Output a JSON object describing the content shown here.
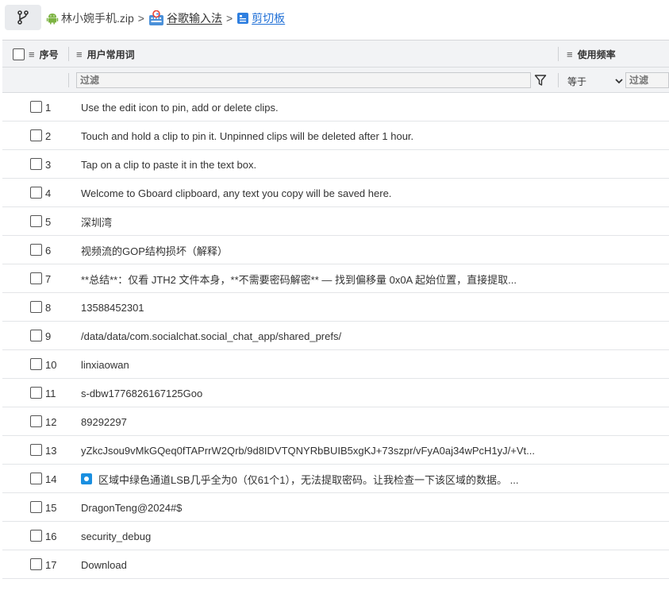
{
  "breadcrumb": {
    "items": [
      {
        "label": "林小婉手机.zip",
        "icon": "android-icon",
        "active": false
      },
      {
        "label": "谷歌输入法",
        "icon": "google-keyboard-icon",
        "active": false
      },
      {
        "label": "剪切板",
        "icon": "clipboard-icon",
        "active": true
      }
    ],
    "separator": ">"
  },
  "table": {
    "columns": {
      "index": "序号",
      "phrase": "用户常用词",
      "frequency": "使用频率"
    },
    "filter": {
      "phrase_placeholder": "过滤",
      "operator": "等于",
      "frequency_placeholder": "过滤"
    },
    "rows": [
      {
        "index": "1",
        "text": "Use the edit icon to pin, add or delete clips."
      },
      {
        "index": "2",
        "text": "Touch and hold a clip to pin it. Unpinned clips will be deleted after 1 hour."
      },
      {
        "index": "3",
        "text": "Tap on a clip to paste it in the text box."
      },
      {
        "index": "4",
        "text": "Welcome to Gboard clipboard, any text you copy will be saved here."
      },
      {
        "index": "5",
        "text": "深圳湾"
      },
      {
        "index": "6",
        "text": "视频流的GOP结构损坏（解释）"
      },
      {
        "index": "7",
        "text": "**总结**：仅看 JTH2 文件本身，**不需要密码解密** — 找到偏移量 0x0A 起始位置，直接提取..."
      },
      {
        "index": "8",
        "text": "13588452301"
      },
      {
        "index": "9",
        "text": "/data/data/com.socialchat.social_chat_app/shared_prefs/"
      },
      {
        "index": "10",
        "text": "linxiaowan"
      },
      {
        "index": "11",
        "text": "s-dbw1776826167125Goo"
      },
      {
        "index": "12",
        "text": "89292297"
      },
      {
        "index": "13",
        "text": "yZkcJsou9vMkGQeq0fTAPrrW2Qrb/9d8IDVTQNYRbBUIB5xgKJ+73szpr/vFyA0aj34wPcH1yJ/+Vt..."
      },
      {
        "index": "14",
        "text": "区域中绿色通道LSB几乎全为0（仅61个1），无法提取密码。让我检查一下该区域的数据。 ..."
      },
      {
        "index": "15",
        "text": "DragonTeng@2024#$"
      },
      {
        "index": "16",
        "text": "security_debug"
      },
      {
        "index": "17",
        "text": "Download"
      }
    ]
  },
  "colors": {
    "highlight_border": "#e8121e",
    "active_link": "#1f6fd6",
    "header_bg": "#f2f3f5"
  }
}
